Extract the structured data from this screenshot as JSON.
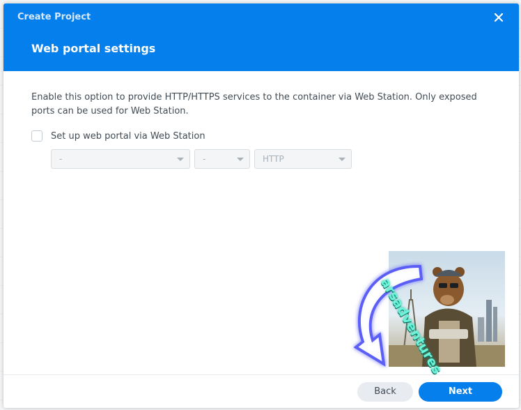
{
  "dialog": {
    "window_title": "Create Project",
    "step_title": "Web portal settings",
    "close_icon": "close-icon"
  },
  "content": {
    "description": "Enable this option to provide HTTP/HTTPS services to the container via Web Station. Only exposed ports can be used for Web Station.",
    "checkbox": {
      "label": "Set up web portal via Web Station",
      "checked": false
    },
    "selects": [
      {
        "value": "-",
        "disabled": true
      },
      {
        "value": "-",
        "disabled": true
      },
      {
        "value": "HTTP",
        "disabled": true
      }
    ]
  },
  "footer": {
    "back_label": "Back",
    "next_label": "Next"
  },
  "watermark": {
    "text": "arsadventures"
  },
  "colors": {
    "accent": "#057feb",
    "text": "#414b55",
    "disabled_text": "#a9b0b8"
  }
}
